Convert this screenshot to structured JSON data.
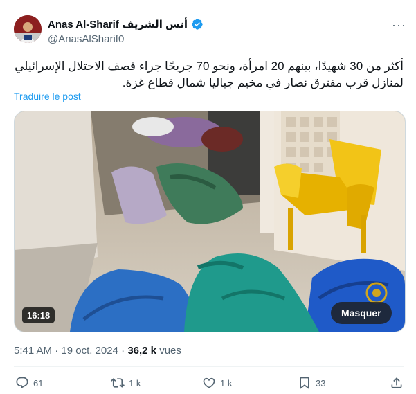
{
  "author": {
    "display_name": "Anas Al-Sharif أنس الشريف",
    "handle": "@AnasAlSharif0",
    "verified": true,
    "accent": "#1d9bf0"
  },
  "tweet": {
    "text_line1": "أكثر من 30 شهيدًا، بينهم 20 امرأة، ونحو 70 جريحًا جراء قصف الاحتلال الإسرائيلي",
    "text_line2": "لمنازل قرب مفترق نصار في مخيم جباليا شمال قطاع غزة.",
    "translate_label": "Traduire le post"
  },
  "media": {
    "duration": "16:18",
    "hide_label": "Masquer"
  },
  "meta": {
    "time": "5:41 AM",
    "separator": "·",
    "date": "19 oct. 2024",
    "views_count": "36,2 k",
    "views_label": "vues"
  },
  "actions": {
    "replies": "61",
    "reposts": "1 k",
    "likes": "1 k",
    "bookmarks": "33",
    "icons": [
      "reply-icon",
      "repost-icon",
      "like-icon",
      "bookmark-icon",
      "share-icon"
    ]
  }
}
